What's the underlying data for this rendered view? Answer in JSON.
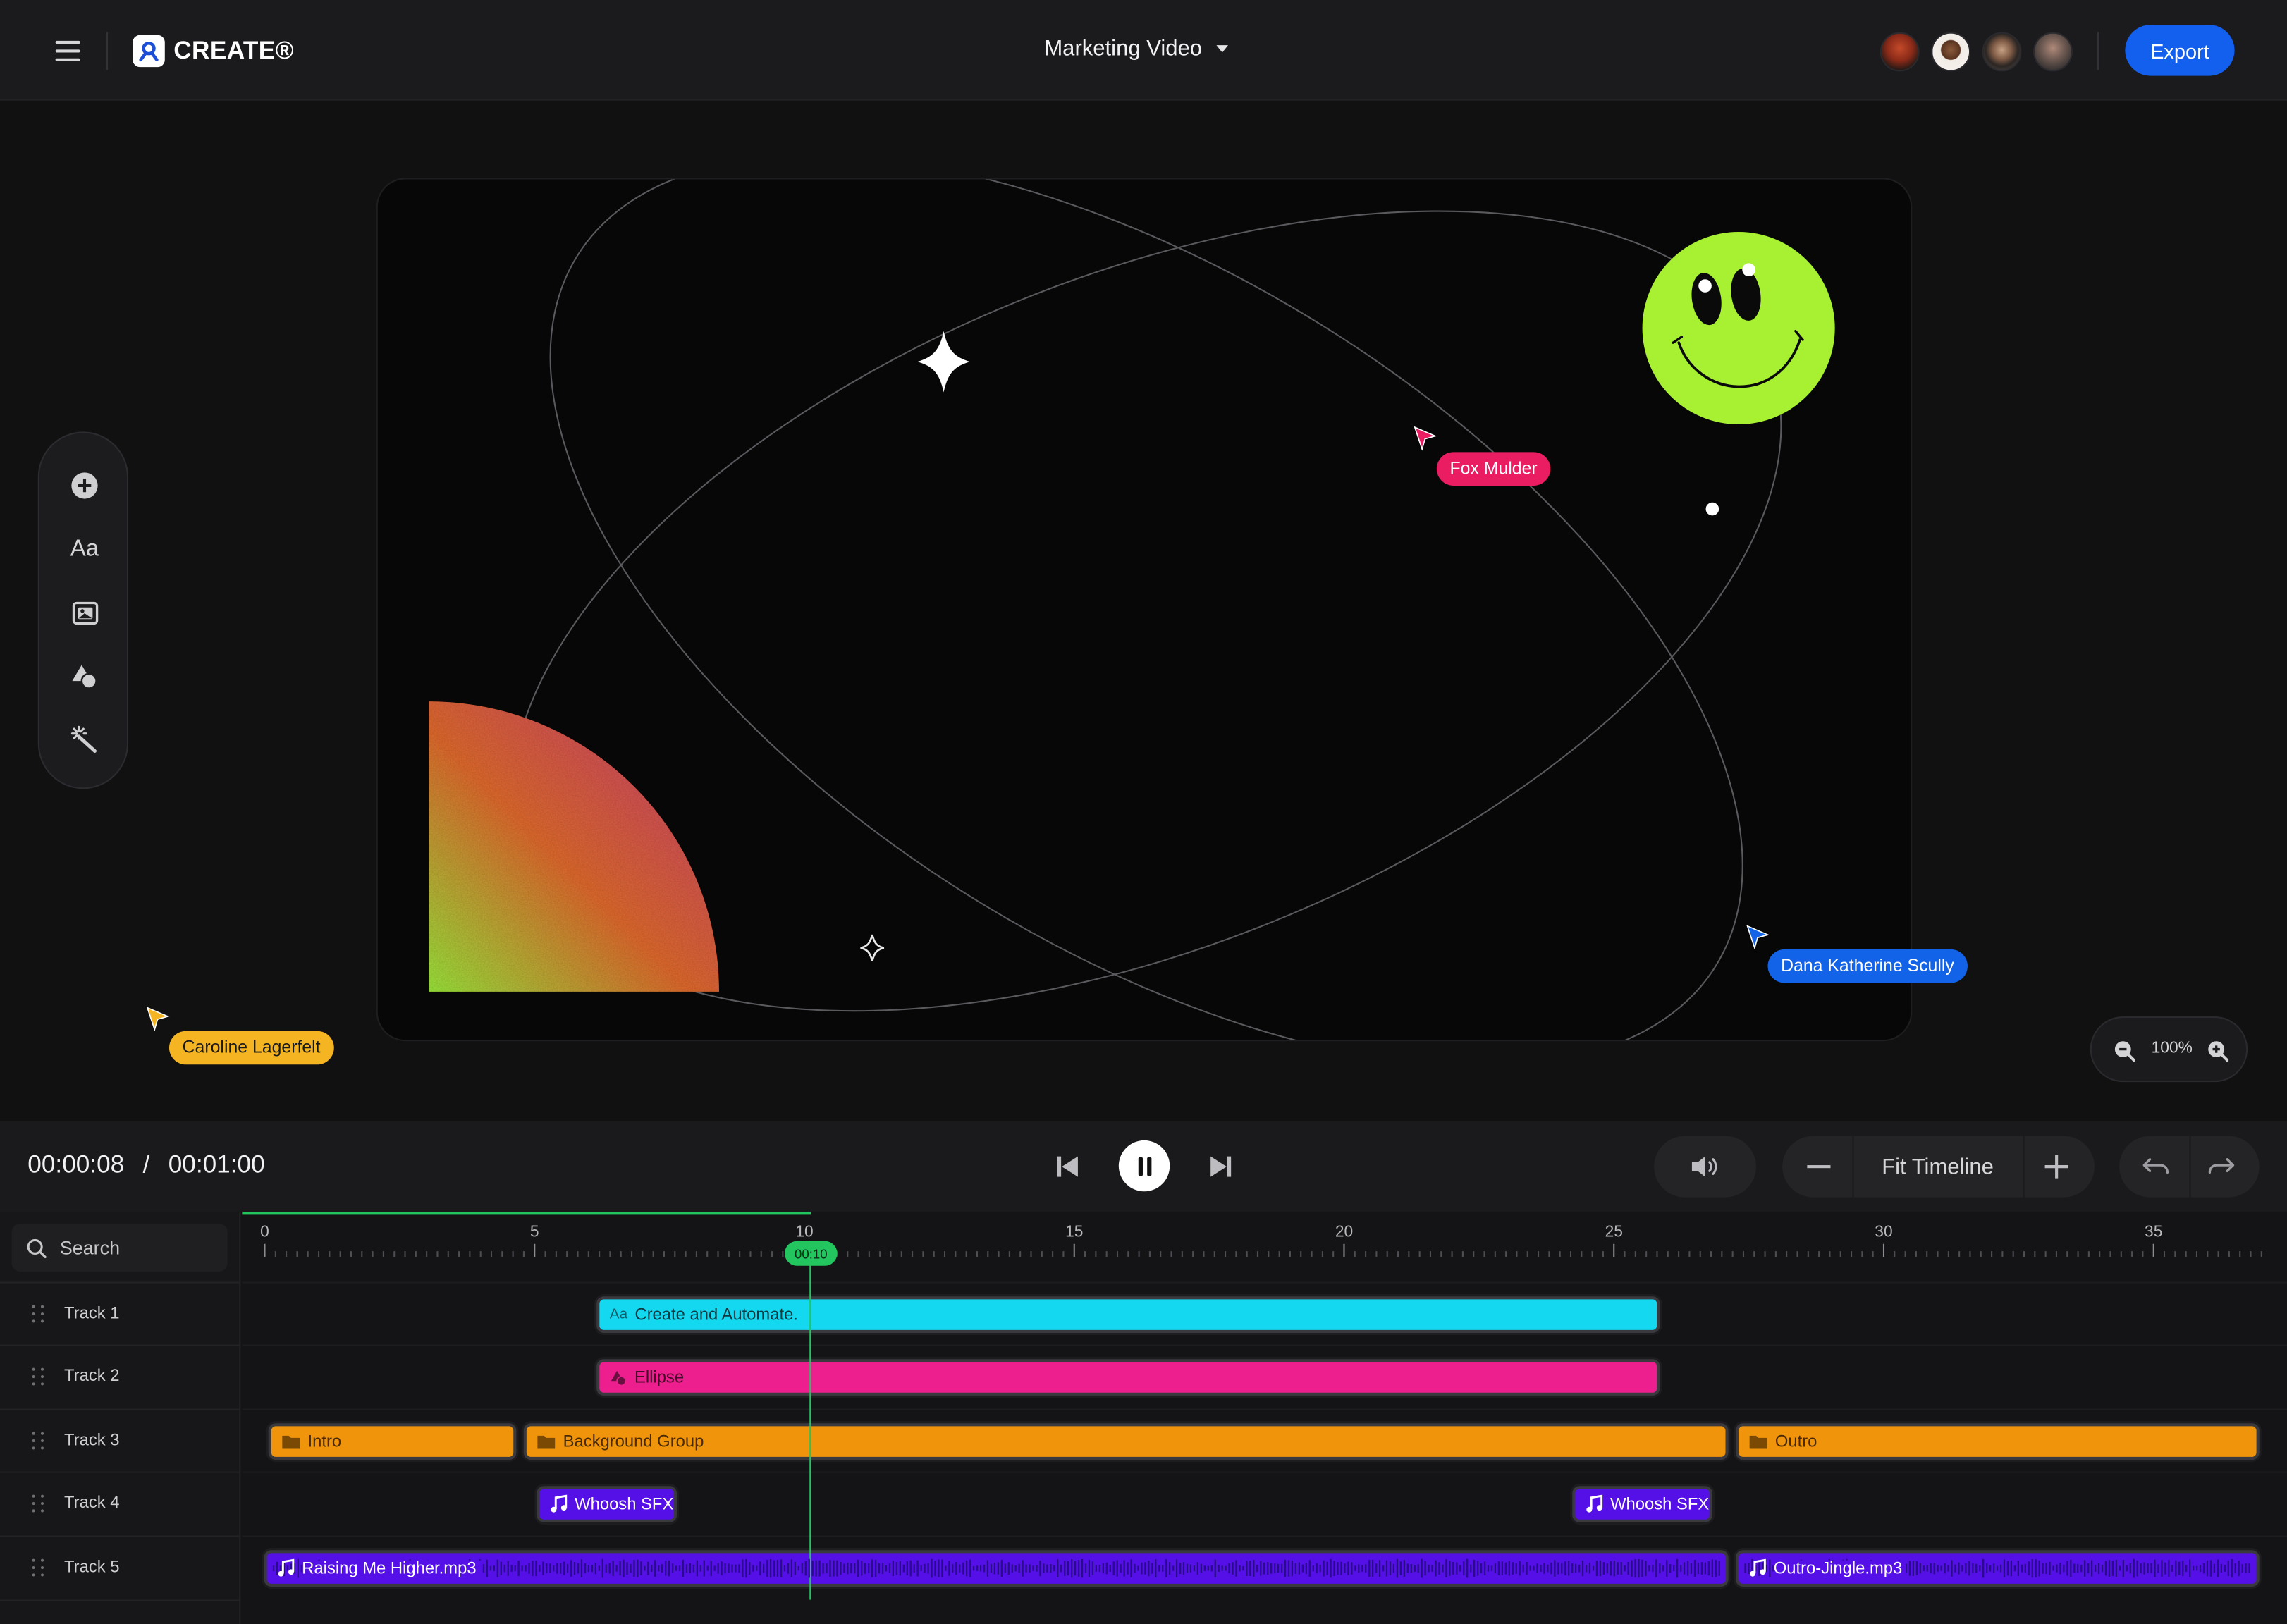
{
  "header": {
    "logo_text": "CREATE®",
    "project_title": "Marketing Video",
    "export_label": "Export",
    "collaborators": [
      "avatar-1",
      "avatar-2",
      "avatar-3",
      "avatar-4"
    ]
  },
  "toolbar": {
    "tools": [
      "add-icon",
      "text-icon",
      "image-icon",
      "shapes-icon",
      "magic-wand-icon"
    ],
    "text_tool_label": "Aa"
  },
  "cursors": {
    "fox": "Fox Mulder",
    "dana": "Dana Katherine Scully",
    "caroline": "Caroline Lagerfelt"
  },
  "zoom": {
    "value": "100%"
  },
  "transport": {
    "current_time": "00:00:08",
    "separator": "/",
    "total_time": "00:01:00",
    "fit_label": "Fit Timeline"
  },
  "timeline": {
    "search_placeholder": "Search",
    "ruler_labels": [
      "0",
      "5",
      "10",
      "15",
      "20",
      "25",
      "30",
      "35"
    ],
    "playhead_label": "00:10",
    "tracks": [
      {
        "name": "Track 1",
        "clips": [
          {
            "label": "Create and Automate.",
            "kind": "text"
          }
        ]
      },
      {
        "name": "Track 2",
        "clips": [
          {
            "label": "Ellipse",
            "kind": "shape"
          }
        ]
      },
      {
        "name": "Track 3",
        "clips": [
          {
            "label": "Intro",
            "kind": "group"
          },
          {
            "label": "Background Group",
            "kind": "group"
          },
          {
            "label": "Outro",
            "kind": "group"
          }
        ]
      },
      {
        "name": "Track 4",
        "clips": [
          {
            "label": "Whoosh SFX",
            "kind": "sfx"
          },
          {
            "label": "Whoosh SFX",
            "kind": "sfx"
          }
        ]
      },
      {
        "name": "Track 5",
        "clips": [
          {
            "label": "Raising Me Higher.mp3",
            "kind": "audio"
          },
          {
            "label": "Outro-Jingle.mp3",
            "kind": "audio"
          }
        ]
      }
    ]
  },
  "colors": {
    "accent": "#1360ef",
    "text_clip": "#13d8f0",
    "shape_clip": "#ed1f8f",
    "group_clip": "#f0940c",
    "audio_clip": "#5510e8",
    "playhead": "#22c55e",
    "smiley": "#a8f032",
    "fox_tag": "#ea1d63",
    "dana_tag": "#1363e8",
    "caroline_tag": "#f5b422"
  }
}
